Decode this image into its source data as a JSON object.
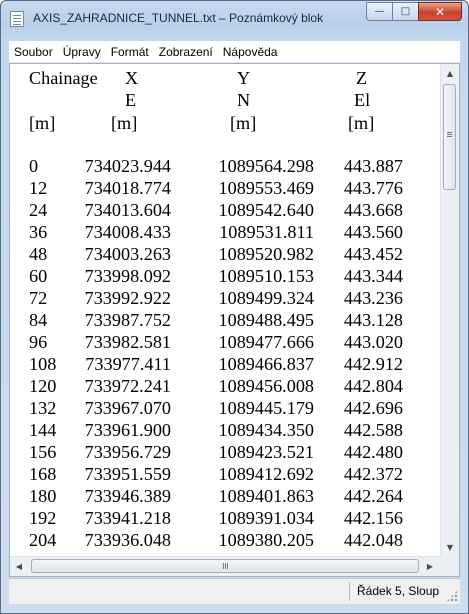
{
  "window": {
    "title": "AXIS_ZAHRADNICE_TUNNEL.txt – Poznámkový blok",
    "buttons": {
      "minimize": "—",
      "maximize": "□",
      "close": "✕"
    }
  },
  "menu": {
    "items": [
      "Soubor",
      "Úpravy",
      "Formát",
      "Zobrazení",
      "Nápověda"
    ]
  },
  "document": {
    "header": {
      "line1": [
        "Chainage",
        "X",
        "Y",
        "Z"
      ],
      "line2": [
        "",
        "E",
        "N",
        "El"
      ],
      "line3": [
        "[m]",
        "[m]",
        "[m]",
        "[m]"
      ]
    },
    "rows": [
      [
        "0",
        "734023.944",
        "1089564.298",
        "443.887"
      ],
      [
        "12",
        "734018.774",
        "1089553.469",
        "443.776"
      ],
      [
        "24",
        "734013.604",
        "1089542.640",
        "443.668"
      ],
      [
        "36",
        "734008.433",
        "1089531.811",
        "443.560"
      ],
      [
        "48",
        "734003.263",
        "1089520.982",
        "443.452"
      ],
      [
        "60",
        "733998.092",
        "1089510.153",
        "443.344"
      ],
      [
        "72",
        "733992.922",
        "1089499.324",
        "443.236"
      ],
      [
        "84",
        "733987.752",
        "1089488.495",
        "443.128"
      ],
      [
        "96",
        "733982.581",
        "1089477.666",
        "443.020"
      ],
      [
        "108",
        "733977.411",
        "1089466.837",
        "442.912"
      ],
      [
        "120",
        "733972.241",
        "1089456.008",
        "442.804"
      ],
      [
        "132",
        "733967.070",
        "1089445.179",
        "442.696"
      ],
      [
        "144",
        "733961.900",
        "1089434.350",
        "442.588"
      ],
      [
        "156",
        "733956.729",
        "1089423.521",
        "442.480"
      ],
      [
        "168",
        "733951.559",
        "1089412.692",
        "442.372"
      ],
      [
        "180",
        "733946.389",
        "1089401.863",
        "442.264"
      ],
      [
        "192",
        "733941.218",
        "1089391.034",
        "442.156"
      ],
      [
        "204",
        "733936.048",
        "1089380.205",
        "442.048"
      ]
    ]
  },
  "status": {
    "position": "Řádek 5, Sloup"
  }
}
